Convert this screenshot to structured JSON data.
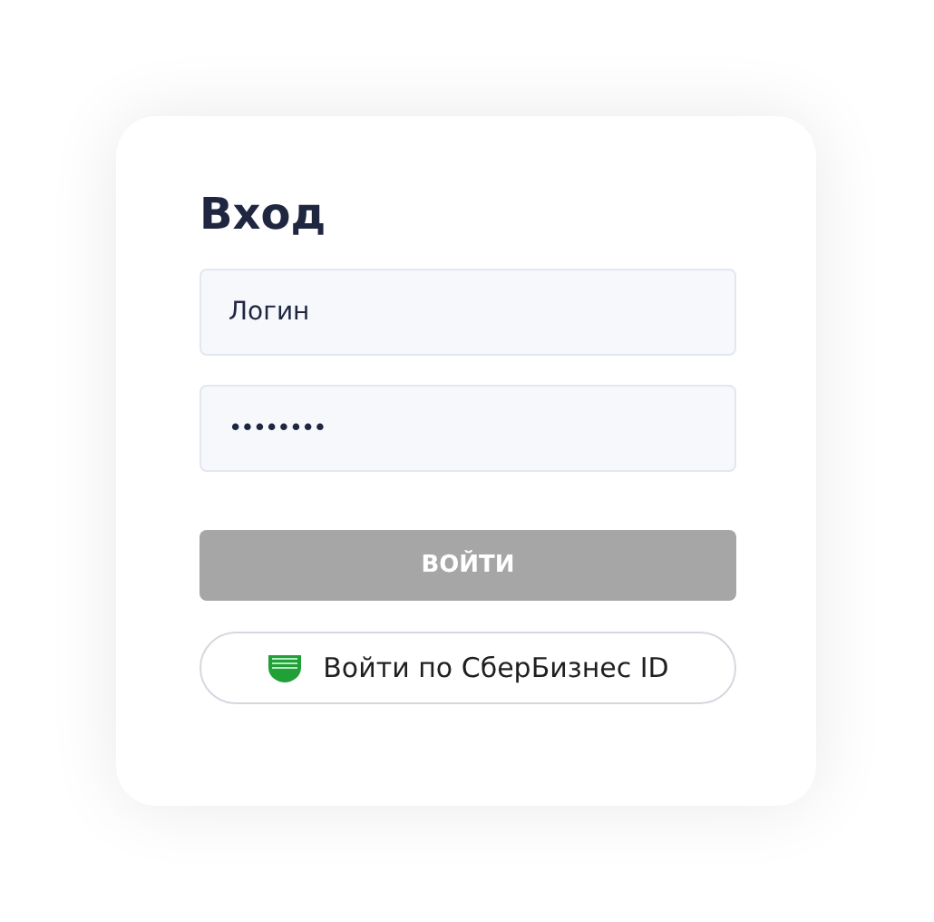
{
  "title": "Вход",
  "fields": [
    {
      "kind": "login",
      "value": "Логин"
    },
    {
      "kind": "password",
      "value": "••••••••"
    }
  ],
  "submit": {
    "label": "ВОЙТИ",
    "disabled": true
  },
  "sber_button": {
    "label": "Войти по СберБизнес ID"
  }
}
